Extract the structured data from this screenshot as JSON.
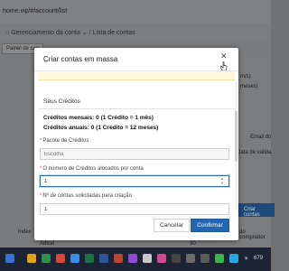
{
  "browser": {
    "url": "home.vip/#/account/list"
  },
  "breadcrumb": {
    "first": "Gerenciamento da conta",
    "separator": "/",
    "second": "Lista de contas"
  },
  "background": {
    "tab_label": "Painel de con",
    "right_labels": [
      "m/s)",
      "meses)",
      "Email do",
      "Data de valida"
    ],
    "action_button": "Criar contas",
    "table_headers": [
      "Index",
      "do comprador"
    ],
    "row_values": [
      "Adicel",
      "30"
    ]
  },
  "modal": {
    "title": "Criar contas em massa",
    "section_title": "Seus Créditos",
    "credits_monthly": "Créditos mensais:  0 (1 Crédito = 1 mês)",
    "credits_yearly": "Créditos anuais:  0 (1 Crédito = 12 meses)",
    "fields": {
      "package_label": "Pacote de Créditos",
      "package_placeholder": "Escolha",
      "credits_label": "O número de Créditos alocados por conta",
      "credits_value": "1",
      "accounts_label": "Nº de contas solicitadas para criação",
      "accounts_value": "1"
    },
    "buttons": {
      "cancel": "Cancelar",
      "confirm": "Confirmar"
    }
  },
  "taskbar": {
    "clock": "679"
  },
  "colors": {
    "primary": "#2566b0",
    "required": "#e04545",
    "overlay": "#6f7173"
  }
}
